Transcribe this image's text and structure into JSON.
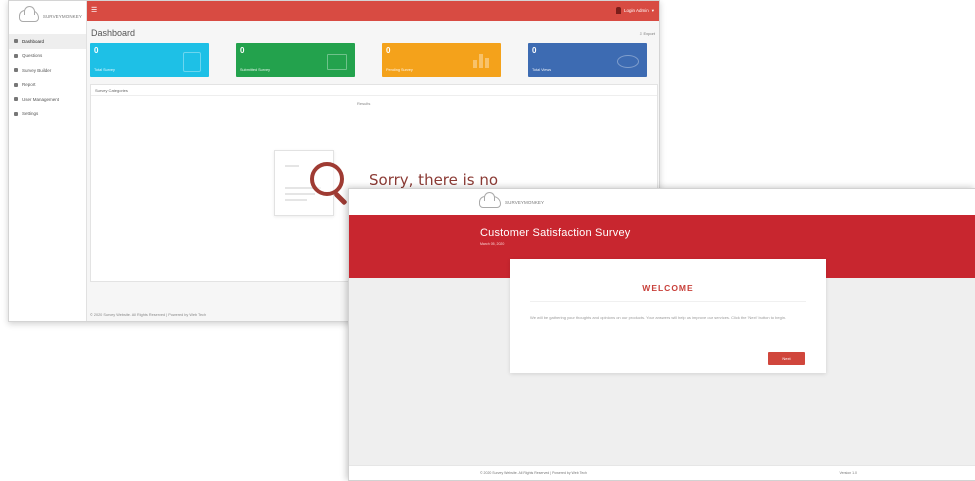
{
  "dashboard": {
    "logo_text": "SURVEYMONKEY",
    "nav": [
      {
        "label": "Dashboard",
        "icon": "home-icon",
        "active": true
      },
      {
        "label": "Questions",
        "icon": "question-icon",
        "active": false
      },
      {
        "label": "Survey Builder",
        "icon": "builder-icon",
        "active": false
      },
      {
        "label": "Report",
        "icon": "report-icon",
        "active": false
      },
      {
        "label": "User Management",
        "icon": "users-icon",
        "active": false
      },
      {
        "label": "Settings",
        "icon": "gear-icon",
        "active": false
      }
    ],
    "topbar": {
      "menu_icon": "☰",
      "user_label": "Login Admin"
    },
    "page_title": "Dashboard",
    "export_label": "Export",
    "stats": [
      {
        "value": "0",
        "label": "Total Survey",
        "color": "#1ec0e6",
        "icon": "document-icon"
      },
      {
        "value": "0",
        "label": "Submitted Survey",
        "color": "#23a24d",
        "icon": "card-icon"
      },
      {
        "value": "0",
        "label": "Pending Survey",
        "color": "#f4a21b",
        "icon": "bar-chart-icon"
      },
      {
        "value": "0",
        "label": "Total Views",
        "color": "#3d6bb2",
        "icon": "eye-icon"
      }
    ],
    "panel_heading": "Survey Categories",
    "panel_subheading": "Results",
    "no_data_text": "Sorry, there is no data",
    "footer": "© 2020 Survey Website. All Rights Reserved | Powered by Web Tech"
  },
  "survey": {
    "logo_text": "SURVEYMONKEY",
    "title": "Customer Satisfaction Survey",
    "date": "March 05, 2020",
    "welcome_heading": "WELCOME",
    "welcome_body": "We will be gathering your thoughts and opinions on our products. Your answers will help us improve our services. Click the 'Next' button to begin.",
    "next_button": "Next",
    "footer_left": "© 2020 Survey Website. All Rights Reserved | Powered by Web Tech",
    "footer_right": "Version 1.0",
    "accent_color": "#c8262f"
  }
}
